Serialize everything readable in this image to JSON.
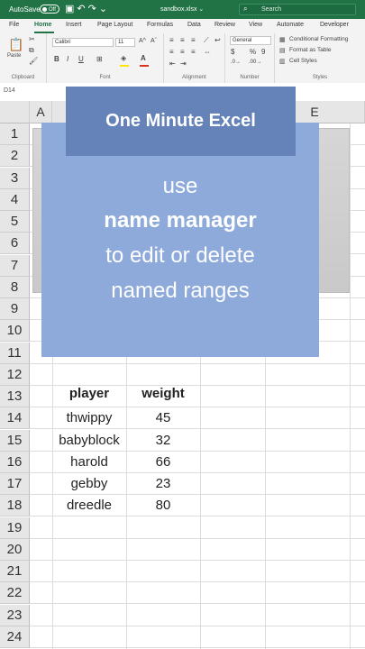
{
  "titlebar": {
    "autosave_label": "AutoSave",
    "autosave_state": "Off",
    "filename": "sandbox.xlsx ⌄",
    "search_placeholder": "Search"
  },
  "menu": {
    "tabs": [
      "File",
      "Home",
      "Insert",
      "Page Layout",
      "Formulas",
      "Data",
      "Review",
      "View",
      "Automate",
      "Developer"
    ],
    "active": "Home"
  },
  "ribbon": {
    "clipboard": {
      "paste_label": "Paste",
      "group_label": "Clipboard"
    },
    "font": {
      "font_name": "Calibri",
      "font_size": "11",
      "bold": "B",
      "italic": "I",
      "underline": "U",
      "group_label": "Font"
    },
    "alignment": {
      "group_label": "Alignment"
    },
    "number": {
      "format": "General",
      "currency": "$",
      "percent": "%",
      "comma": "9",
      "group_label": "Number"
    },
    "styles": {
      "conditional_formatting": "Conditional Formatting",
      "format_as_table": "Format as Table",
      "cell_styles": "Cell Styles",
      "group_label": "Styles"
    }
  },
  "namebox": "D14",
  "sheet": {
    "columns": [
      "A",
      "E"
    ],
    "rows": [
      "1",
      "2",
      "3",
      "4",
      "5",
      "6",
      "7",
      "8",
      "9",
      "10",
      "11",
      "12",
      "13",
      "14",
      "15",
      "16",
      "17",
      "18",
      "19",
      "20",
      "21",
      "22",
      "23",
      "24"
    ],
    "table_headers": [
      "player",
      "weight"
    ],
    "table_rows": [
      [
        "thwippy",
        "45"
      ],
      [
        "babyblock",
        "32"
      ],
      [
        "harold",
        "66"
      ],
      [
        "gebby",
        "23"
      ],
      [
        "dreedle",
        "80"
      ]
    ]
  },
  "overlay": {
    "banner": "One Minute Excel",
    "line1": "use",
    "line2": "name manager",
    "line3": "to edit or delete",
    "line4": "named ranges"
  },
  "colors": {
    "excel_green": "#217346",
    "banner_blue": "#6583b8",
    "box_blue": "#8eaadb"
  }
}
